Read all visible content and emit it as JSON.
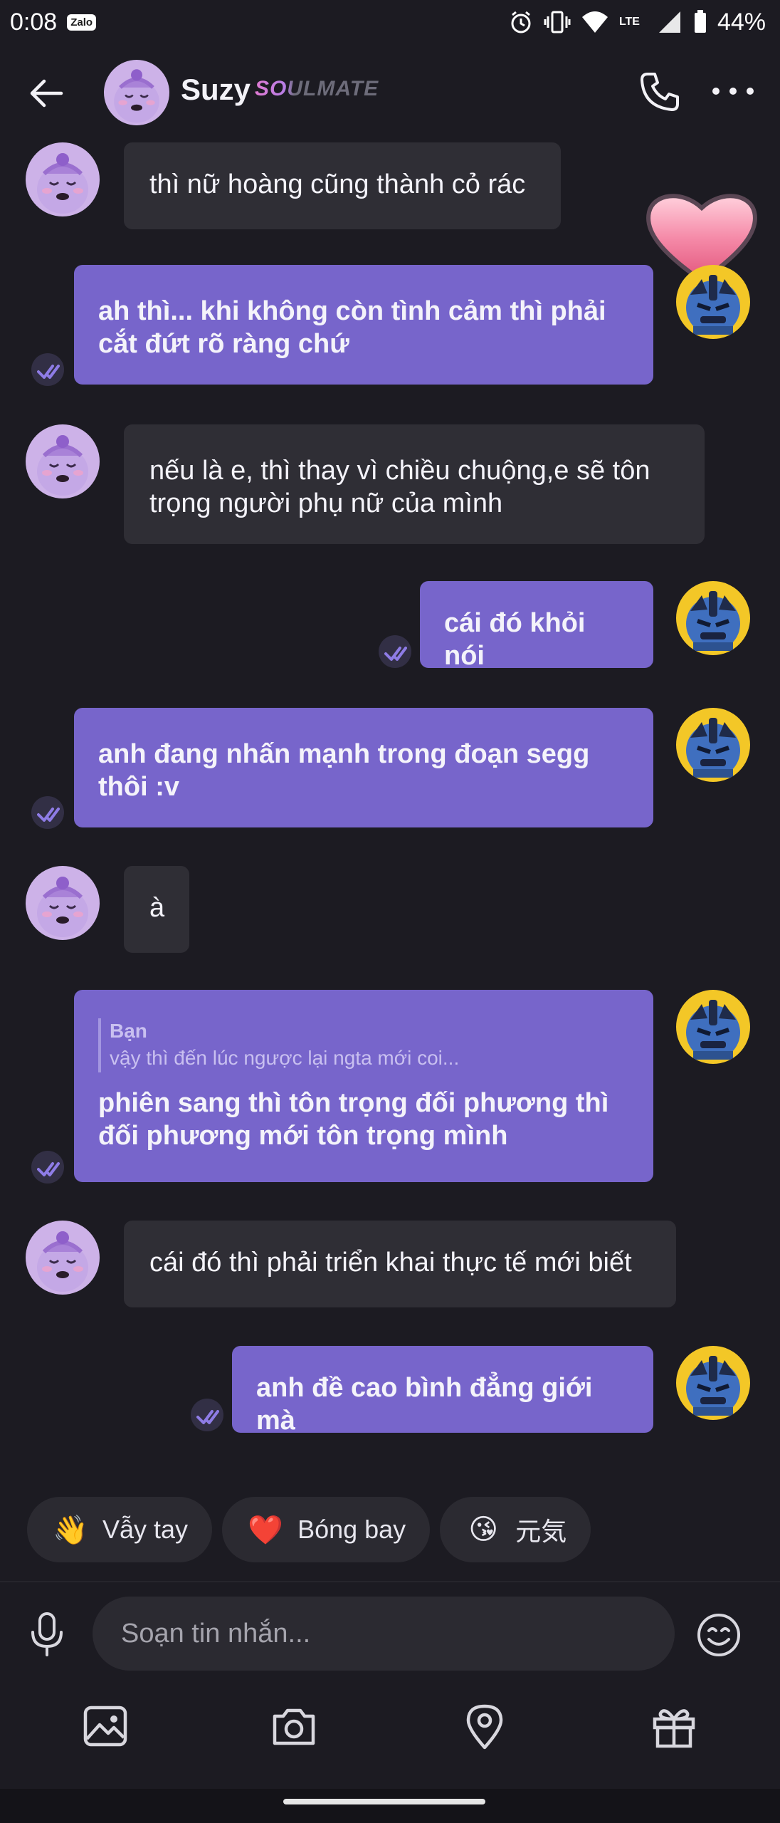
{
  "status_bar": {
    "time": "0:08",
    "app_badge": "Zalo",
    "network": "LTE",
    "battery": "44%"
  },
  "header": {
    "name": "Suzy",
    "tag": "SOULMATE"
  },
  "messages": [
    {
      "side": "in",
      "text": "thì nữ hoàng cũng thành cỏ rác"
    },
    {
      "side": "out",
      "text": "ah thì... khi không còn tình cảm thì phải cắt đứt rõ ràng chứ"
    },
    {
      "side": "in",
      "text": "nếu là e, thì thay vì chiều chuộng,e sẽ tôn trọng người phụ nữ của mình"
    },
    {
      "side": "out",
      "text": "cái đó khỏi nói"
    },
    {
      "side": "out",
      "text": "anh đang nhấn mạnh trong đoạn segg thôi :v"
    },
    {
      "side": "in",
      "text": "à"
    },
    {
      "side": "out",
      "quote_name": "Bạn",
      "quote_text": "vậy thì đến lúc ngược lại ngta mới coi...",
      "text": "phiên sang thì tôn trọng đối phương thì đối phương mới tôn trọng mình"
    },
    {
      "side": "in",
      "text": "cái đó thì phải triển khai thực tế mới biết"
    },
    {
      "side": "out",
      "text": "anh đề cao bình đẳng giới mà"
    }
  ],
  "quick_replies": [
    {
      "emoji": "👋",
      "label": "Vẫy tay"
    },
    {
      "emoji": "❤️",
      "label": "Bóng bay"
    },
    {
      "emoji": "😘",
      "label": "元気"
    }
  ],
  "composer": {
    "placeholder": "Soạn tin nhắn..."
  },
  "colors": {
    "background": "#1c1b22",
    "outgoing_bubble": "#7765cb",
    "incoming_bubble": "#2f2e35",
    "accent_pink": "#e07ad2"
  },
  "icons": [
    "back-arrow-icon",
    "phone-icon",
    "more-icon",
    "mic-icon",
    "emoji-icon",
    "image-icon",
    "camera-icon",
    "location-icon",
    "gift-icon",
    "seen-check-icon",
    "heart-icon"
  ]
}
